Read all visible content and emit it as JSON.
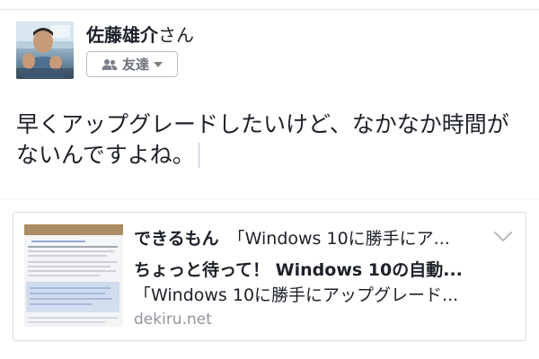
{
  "user": {
    "name": "佐藤雄介",
    "honorific": "さん",
    "avatar_icon": "user-avatar-photo"
  },
  "audience": {
    "label": "友達",
    "icon": "friends-icon",
    "dropdown_icon": "caret-down-icon"
  },
  "post": {
    "lines": [
      "早くアップグレードしたいけど、なかなか時間が",
      "ないんですよね。"
    ]
  },
  "link_preview": {
    "site_name": "できるもん",
    "site_snippet": "「Windows 10に勝手にア...",
    "title": "ちょっと待って！ Windows 10の自動...",
    "description": "「Windows 10に勝手にアップグレード...",
    "domain": "dekiru.net",
    "chevron_icon": "chevron-down-icon",
    "thumbnail_icon": "article-thumbnail"
  },
  "colors": {
    "text": "#1d2129",
    "muted": "#90949c",
    "border": "#dadde1",
    "button_text": "#6a7077"
  }
}
